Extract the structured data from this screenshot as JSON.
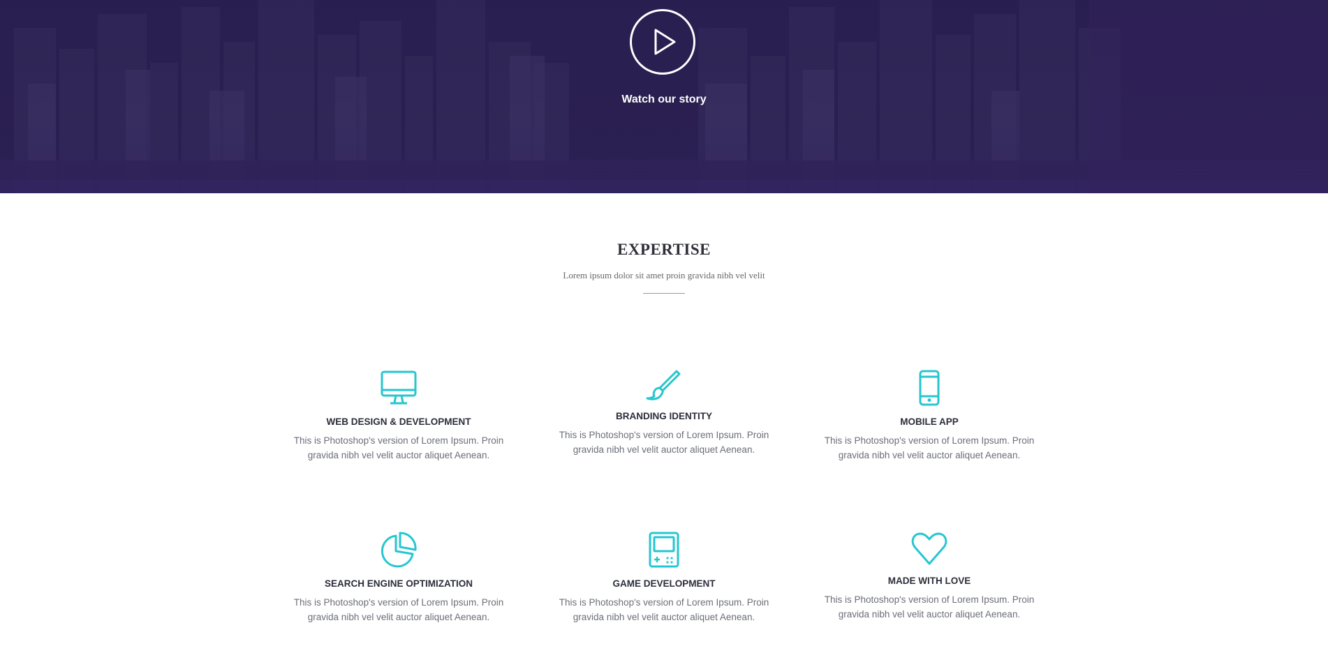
{
  "hero": {
    "watch_label": "Watch our story"
  },
  "expertise": {
    "title": "EXPERTISE",
    "subtitle": "Lorem ipsum dolor sit amet proin gravida nibh vel velit"
  },
  "colors": {
    "accent": "#26c6d0",
    "hero_overlay": "#2a1f4d",
    "heading": "#2b2d3a",
    "body_text": "#6b6e78"
  },
  "cards": [
    {
      "icon": "monitor-icon",
      "title": "WEB DESIGN & DEVELOPMENT",
      "text": "This is Photoshop's version of Lorem Ipsum. Proin gravida nibh vel velit auctor aliquet Aenean."
    },
    {
      "icon": "brush-icon",
      "title": "BRANDING IDENTITY",
      "text": "This is Photoshop's version of Lorem Ipsum. Proin gravida nibh vel velit auctor aliquet Aenean."
    },
    {
      "icon": "smartphone-icon",
      "title": "MOBILE APP",
      "text": "This is Photoshop's version of Lorem Ipsum. Proin gravida nibh vel velit auctor aliquet Aenean."
    },
    {
      "icon": "pie-chart-icon",
      "title": "SEARCH ENGINE OPTIMIZATION",
      "text": "This is Photoshop's version of Lorem Ipsum. Proin gravida nibh vel velit auctor aliquet Aenean."
    },
    {
      "icon": "gameboy-icon",
      "title": "GAME DEVELOPMENT",
      "text": "This is Photoshop's version of Lorem Ipsum. Proin gravida nibh vel velit auctor aliquet Aenean."
    },
    {
      "icon": "heart-icon",
      "title": "MADE WITH LOVE",
      "text": "This is Photoshop's version of Lorem Ipsum. Proin gravida nibh vel velit auctor aliquet Aenean."
    }
  ]
}
